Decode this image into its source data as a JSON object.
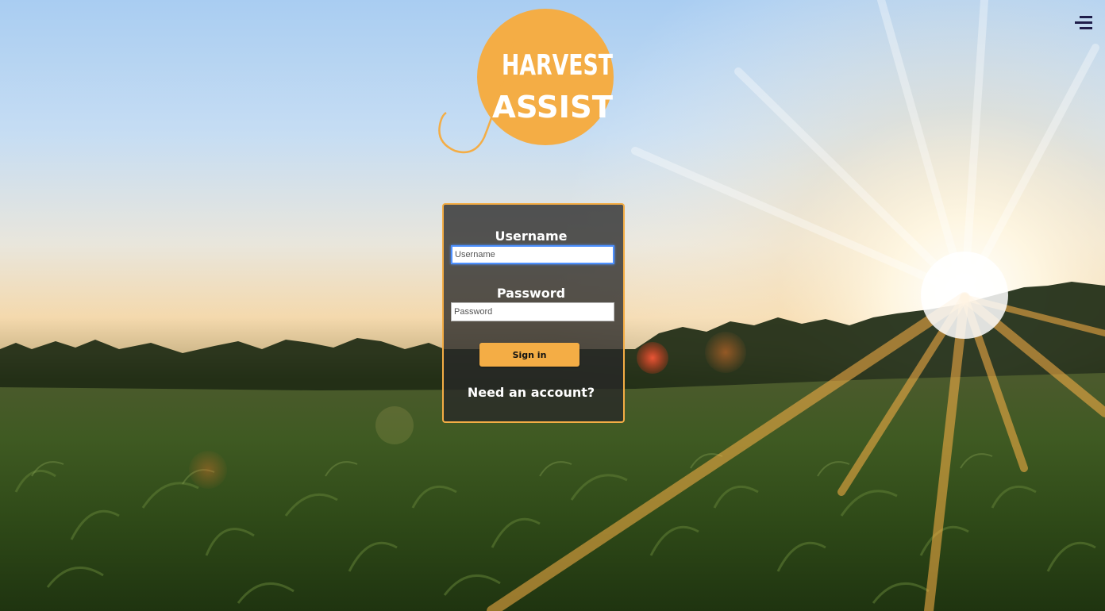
{
  "logo": {
    "line1": "HARVEST",
    "line2": "ASSIST",
    "accent_color": "#f4ad45"
  },
  "header": {
    "menu_icon": "hamburger-menu-icon",
    "menu_color": "#1f1d4a"
  },
  "login": {
    "username_label": "Username",
    "username_placeholder": "Username",
    "password_label": "Password",
    "password_placeholder": "Password",
    "signin_label": "Sign in",
    "need_account_label": "Need an account?"
  },
  "colors": {
    "accent": "#f4ad45",
    "focus": "#4d90fe"
  }
}
